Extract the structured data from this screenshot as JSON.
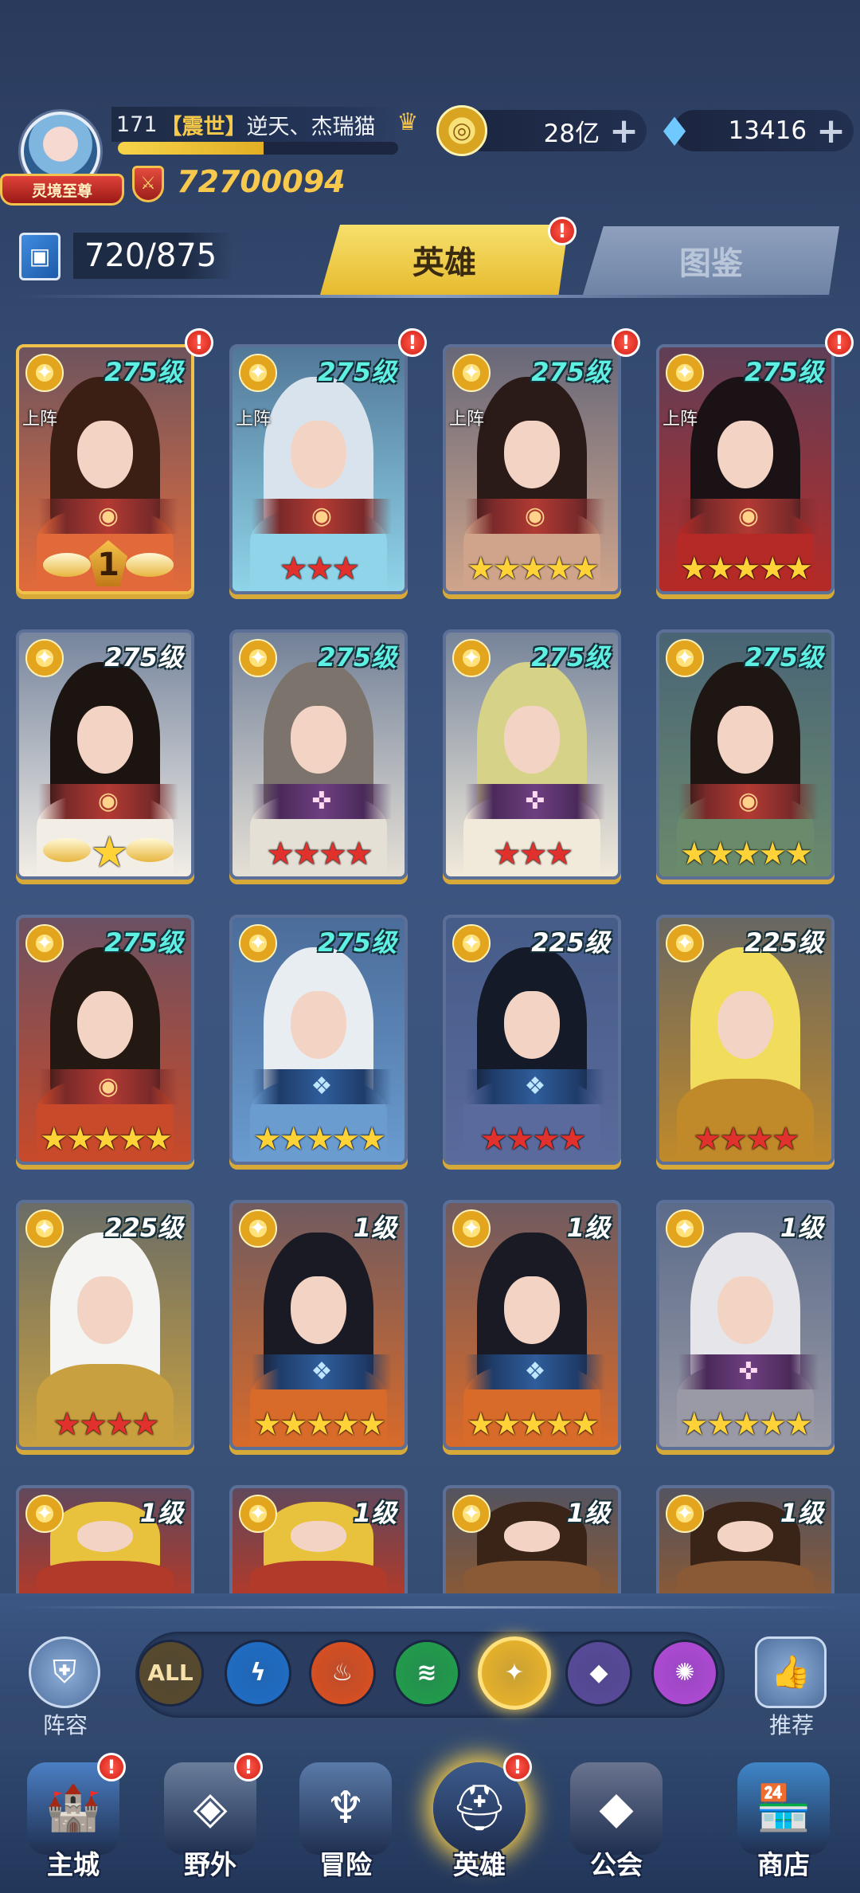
{
  "player": {
    "level": "171",
    "guild_tag": "【震世】",
    "name": "逆天、杰瑞猫",
    "vip_title": "灵境至尊",
    "power": "72700094",
    "exp_percent": 0.52
  },
  "currency": {
    "coins": "28亿",
    "gems": "13416",
    "add_symbol": "+"
  },
  "collection": {
    "count": "720/875"
  },
  "tabs": {
    "heroes": "英雄",
    "codex": "图鉴",
    "alert": "!"
  },
  "deploy_label": "上阵",
  "heroes": [
    {
      "level": "275级",
      "deployed": true,
      "stars": "★★★",
      "star_color": "rank",
      "rank_number": "1",
      "alert": true,
      "level_color": "cyan",
      "emblem": "red",
      "palette": [
        "#3b1e14",
        "#e26a3a"
      ]
    },
    {
      "level": "275级",
      "deployed": true,
      "stars": "★★★",
      "star_color": "red",
      "alert": true,
      "level_color": "cyan",
      "emblem": "red",
      "palette": [
        "#d9e3ee",
        "#8fd4e8"
      ]
    },
    {
      "level": "275级",
      "deployed": true,
      "stars": "★★★★★",
      "star_color": "yellow",
      "alert": true,
      "level_color": "cyan",
      "emblem": "red",
      "palette": [
        "#2a1a18",
        "#cfa48a"
      ]
    },
    {
      "level": "275级",
      "deployed": true,
      "stars": "★★★★★",
      "star_color": "yellow",
      "alert": true,
      "level_color": "cyan",
      "emblem": "red",
      "palette": [
        "#1a1214",
        "#b52a26"
      ]
    },
    {
      "level": "275级",
      "deployed": false,
      "stars": "★",
      "star_color": "rank-gold",
      "alert": false,
      "level_color": "white",
      "emblem": "red",
      "palette": [
        "#1c1410",
        "#f2eee6"
      ]
    },
    {
      "level": "275级",
      "deployed": false,
      "stars": "★★★★",
      "star_color": "red",
      "alert": false,
      "level_color": "cyan",
      "emblem": "purple",
      "palette": [
        "#7c746c",
        "#e5e0d6"
      ]
    },
    {
      "level": "275级",
      "deployed": false,
      "stars": "★★★",
      "star_color": "red",
      "alert": false,
      "level_color": "cyan",
      "emblem": "purple",
      "palette": [
        "#d6d288",
        "#f1eadb"
      ]
    },
    {
      "level": "275级",
      "deployed": false,
      "stars": "★★★★★",
      "star_color": "yellow",
      "alert": false,
      "level_color": "cyan",
      "emblem": "red",
      "palette": [
        "#1e1612",
        "#6a8a6c"
      ]
    },
    {
      "level": "275级",
      "deployed": false,
      "stars": "★★★★★",
      "star_color": "yellow",
      "alert": false,
      "level_color": "cyan",
      "emblem": "red",
      "palette": [
        "#241812",
        "#c84a2a"
      ]
    },
    {
      "level": "275级",
      "deployed": false,
      "stars": "★★★★★",
      "star_color": "yellow",
      "alert": false,
      "level_color": "cyan",
      "emblem": "blue",
      "palette": [
        "#e8edf2",
        "#6a9cd0"
      ]
    },
    {
      "level": "225级",
      "deployed": false,
      "stars": "★★★★",
      "star_color": "red",
      "alert": false,
      "level_color": "white",
      "emblem": "blue",
      "palette": [
        "#141a28",
        "#5a6a9c"
      ]
    },
    {
      "level": "225级",
      "deployed": false,
      "stars": "★★★★",
      "star_color": "red",
      "alert": false,
      "level_color": "white",
      "emblem": "none",
      "palette": [
        "#f2dc5c",
        "#c08a2a"
      ]
    },
    {
      "level": "225级",
      "deployed": false,
      "stars": "★★★★",
      "star_color": "red",
      "alert": false,
      "level_color": "white",
      "emblem": "none",
      "palette": [
        "#f4f4f2",
        "#c8a040"
      ]
    },
    {
      "level": "1级",
      "deployed": false,
      "stars": "★★★★★",
      "star_color": "yellow",
      "alert": false,
      "level_color": "white",
      "emblem": "blue",
      "palette": [
        "#1a1a24",
        "#d86a2a"
      ]
    },
    {
      "level": "1级",
      "deployed": false,
      "stars": "★★★★★",
      "star_color": "yellow",
      "alert": false,
      "level_color": "white",
      "emblem": "blue",
      "palette": [
        "#1a1a24",
        "#d86a2a"
      ]
    },
    {
      "level": "1级",
      "deployed": false,
      "stars": "★★★★★",
      "star_color": "yellow",
      "alert": false,
      "level_color": "white",
      "emblem": "purple",
      "palette": [
        "#e6e6ea",
        "#9a9aa6"
      ]
    },
    {
      "level": "1级",
      "deployed": false,
      "stars": "",
      "star_color": "yellow",
      "alert": false,
      "level_color": "white",
      "emblem": "none",
      "palette": [
        "#e8c23c",
        "#b23a2a"
      ]
    },
    {
      "level": "1级",
      "deployed": false,
      "stars": "",
      "star_color": "yellow",
      "alert": false,
      "level_color": "white",
      "emblem": "none",
      "palette": [
        "#e8c23c",
        "#b23a2a"
      ]
    },
    {
      "level": "1级",
      "deployed": false,
      "stars": "",
      "star_color": "yellow",
      "alert": false,
      "level_color": "white",
      "emblem": "none",
      "palette": [
        "#3a2418",
        "#8a5a36"
      ]
    },
    {
      "level": "1级",
      "deployed": false,
      "stars": "",
      "star_color": "yellow",
      "alert": false,
      "level_color": "white",
      "emblem": "none",
      "palette": [
        "#3a2418",
        "#8a5a36"
      ]
    }
  ],
  "filters": {
    "lineup_label": "阵容",
    "recommend_label": "推荐",
    "all_label": "ALL",
    "elements": [
      {
        "name": "all",
        "color": "#5a4a2a",
        "glyph": "ALL"
      },
      {
        "name": "water",
        "color": "#1f6fc8",
        "glyph": "ϟ"
      },
      {
        "name": "fire",
        "color": "#e0501e",
        "glyph": "♨"
      },
      {
        "name": "wind",
        "color": "#22a04a",
        "glyph": "≋"
      },
      {
        "name": "light",
        "color": "#f0b828",
        "glyph": "✦"
      },
      {
        "name": "dark",
        "color": "#5a4a9a",
        "glyph": "◆"
      },
      {
        "name": "chaos",
        "color": "#b44ad8",
        "glyph": "✺"
      }
    ],
    "selected": "light"
  },
  "nav": [
    {
      "label": "主城",
      "icon": "castle-icon",
      "alert": true
    },
    {
      "label": "野外",
      "icon": "portal-icon",
      "alert": true
    },
    {
      "label": "冒险",
      "icon": "adventure-icon",
      "alert": false
    },
    {
      "label": "英雄",
      "icon": "helmet-icon",
      "alert": true,
      "active": true
    },
    {
      "label": "公会",
      "icon": "guild-banner-icon",
      "alert": false
    },
    {
      "label": "商店",
      "icon": "shop-icon",
      "alert": false
    }
  ]
}
